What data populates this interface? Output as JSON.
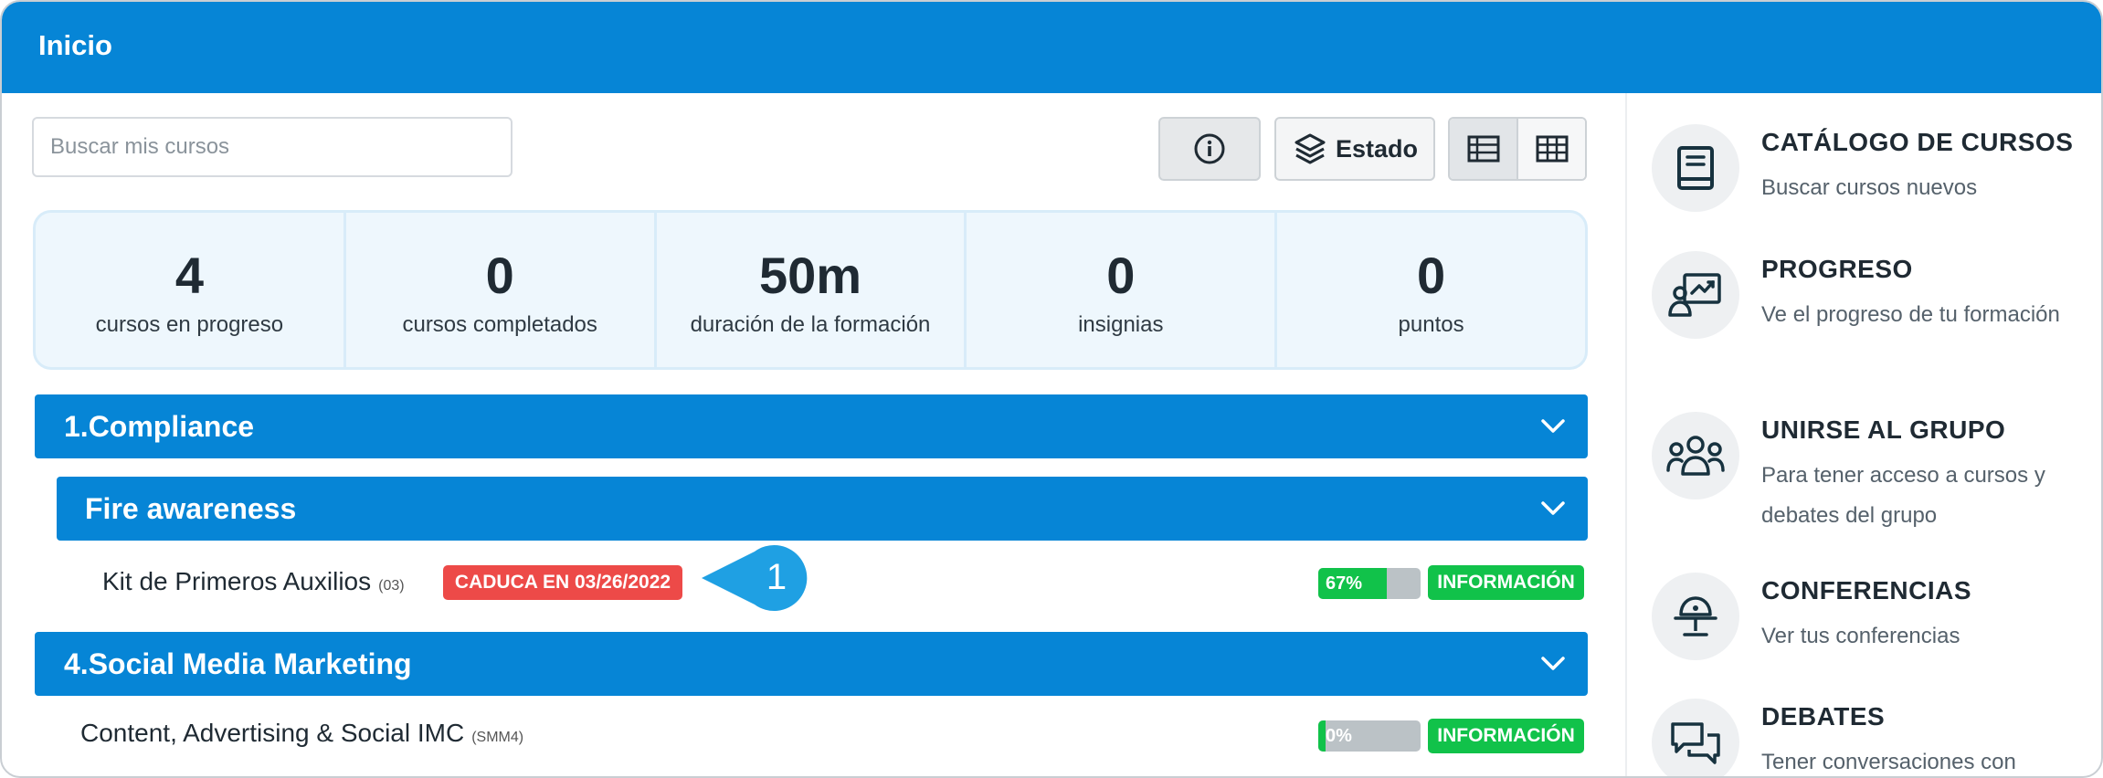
{
  "header": {
    "title": "Inicio"
  },
  "search": {
    "placeholder": "Buscar mis cursos"
  },
  "toolbar": {
    "estado_label": "Estado"
  },
  "stats": [
    {
      "value": "4",
      "label": "cursos en progreso"
    },
    {
      "value": "0",
      "label": "cursos completados"
    },
    {
      "value": "50m",
      "label": "duración de la formación"
    },
    {
      "value": "0",
      "label": "insignias"
    },
    {
      "value": "0",
      "label": "puntos"
    }
  ],
  "groups": [
    {
      "title": "1.Compliance",
      "subgroups": [
        {
          "title": "Fire awareness",
          "courses": [
            {
              "name": "Kit de Primeros Auxilios",
              "code": "(03)",
              "badge": "CADUCA EN 03/26/2022",
              "progress_label": "67%",
              "progress": 0.67,
              "info_label": "INFORMACIÓN"
            }
          ]
        }
      ]
    },
    {
      "title": "4.Social Media Marketing",
      "courses": [
        {
          "name": "Content, Advertising & Social IMC",
          "code": "(SMM4)",
          "progress_label": "0%",
          "progress": 0.0,
          "info_label": "INFORMACIÓN"
        }
      ]
    }
  ],
  "callout": {
    "number": "1"
  },
  "sidebar": {
    "items": [
      {
        "title": "CATÁLOGO DE CURSOS",
        "desc": "Buscar cursos nuevos",
        "icon": "book-icon"
      },
      {
        "title": "PROGRESO",
        "desc": "Ve el progreso de tu formación",
        "icon": "progress-chart-icon"
      },
      {
        "title": "UNIRSE AL GRUPO",
        "desc": "Para tener acceso a cursos y debates del grupo",
        "icon": "group-icon"
      },
      {
        "title": "CONFERENCIAS",
        "desc": "Ver tus conferencias",
        "icon": "conference-icon"
      },
      {
        "title": "DEBATES",
        "desc": "Tener conversaciones con",
        "icon": "discussion-icon"
      }
    ]
  },
  "colors": {
    "primary": "#0685d6",
    "success": "#11c24a",
    "danger": "#ed4a48",
    "stats_bg": "#eef7fd"
  }
}
